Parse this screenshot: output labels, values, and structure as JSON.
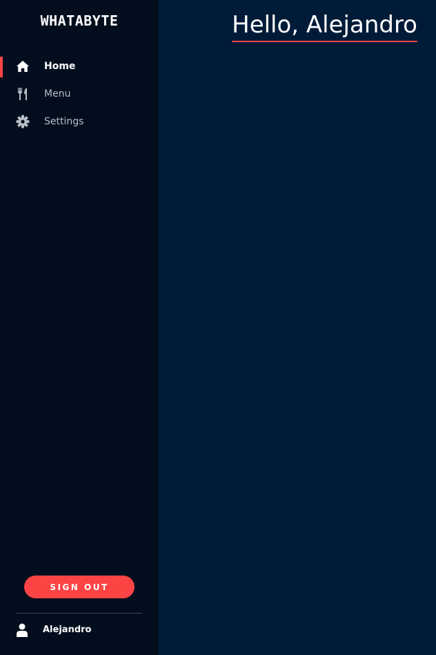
{
  "brand": {
    "name": "WHATABYTE"
  },
  "sidebar": {
    "items": [
      {
        "label": "Home",
        "icon": "home-icon",
        "active": true
      },
      {
        "label": "Menu",
        "icon": "utensils-icon",
        "active": false
      },
      {
        "label": "Settings",
        "icon": "gear-icon",
        "active": false
      }
    ],
    "sign_out_label": "SIGN OUT",
    "user": {
      "name": "Alejandro",
      "icon": "user-icon"
    }
  },
  "main": {
    "greeting": "Hello, Alejandro"
  },
  "colors": {
    "accent": "#fd4445",
    "sidebar_bg": "#020e1d",
    "main_bg": "#001b38",
    "inactive_text": "#b8bec8"
  }
}
